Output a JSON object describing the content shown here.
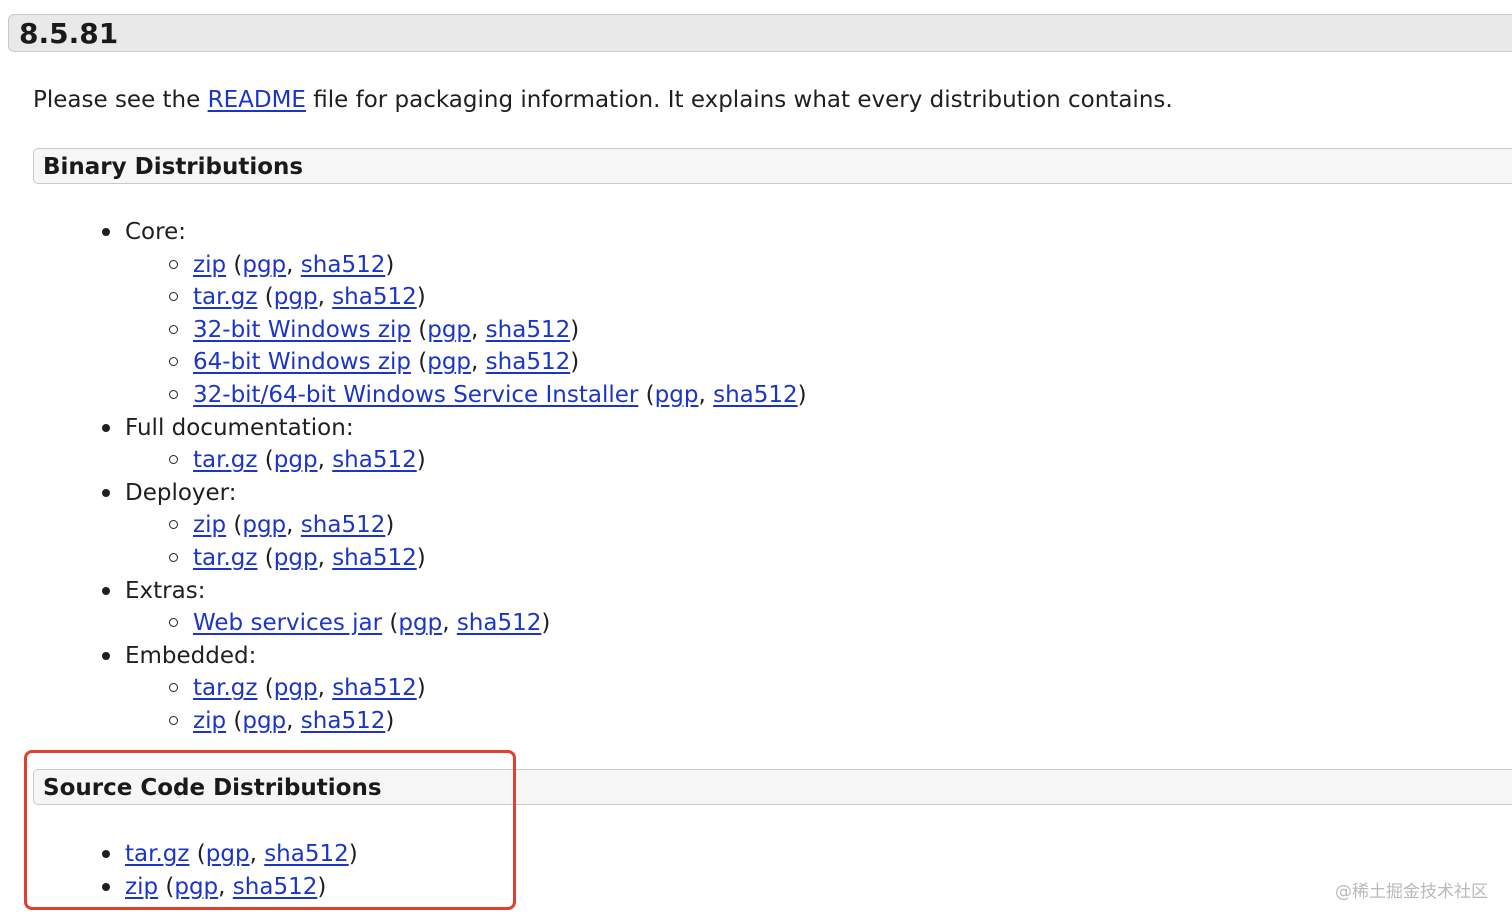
{
  "version": "8.5.81",
  "intro": {
    "before": "Please see the ",
    "link": "README",
    "after": " file for packaging information. It explains what every distribution contains."
  },
  "binary": {
    "title": "Binary Distributions",
    "core": {
      "label": "Core:",
      "items": [
        {
          "name": "zip",
          "pgp": "pgp",
          "sha": "sha512"
        },
        {
          "name": "tar.gz",
          "pgp": "pgp",
          "sha": "sha512"
        },
        {
          "name": "32-bit Windows zip",
          "pgp": "pgp",
          "sha": "sha512"
        },
        {
          "name": "64-bit Windows zip",
          "pgp": "pgp",
          "sha": "sha512"
        },
        {
          "name": "32-bit/64-bit Windows Service Installer",
          "pgp": "pgp",
          "sha": "sha512"
        }
      ]
    },
    "docs": {
      "label": "Full documentation:",
      "items": [
        {
          "name": "tar.gz",
          "pgp": "pgp",
          "sha": "sha512"
        }
      ]
    },
    "deployer": {
      "label": "Deployer:",
      "items": [
        {
          "name": "zip",
          "pgp": "pgp",
          "sha": "sha512"
        },
        {
          "name": "tar.gz",
          "pgp": "pgp",
          "sha": "sha512"
        }
      ]
    },
    "extras": {
      "label": "Extras:",
      "items": [
        {
          "name": "Web services jar",
          "pgp": "pgp",
          "sha": "sha512"
        }
      ]
    },
    "embedded": {
      "label": "Embedded:",
      "items": [
        {
          "name": "tar.gz",
          "pgp": "pgp",
          "sha": "sha512"
        },
        {
          "name": "zip",
          "pgp": "pgp",
          "sha": "sha512"
        }
      ]
    }
  },
  "source": {
    "title": "Source Code Distributions",
    "items": [
      {
        "name": "tar.gz",
        "pgp": "pgp",
        "sha": "sha512"
      },
      {
        "name": "zip",
        "pgp": "pgp",
        "sha": "sha512"
      }
    ]
  },
  "punct": {
    "open": " (",
    "sep": ", ",
    "close": ")"
  },
  "watermark": "@稀土掘金技术社区",
  "colors": {
    "link": "#1b35c9",
    "highlight": "#e0412f"
  }
}
